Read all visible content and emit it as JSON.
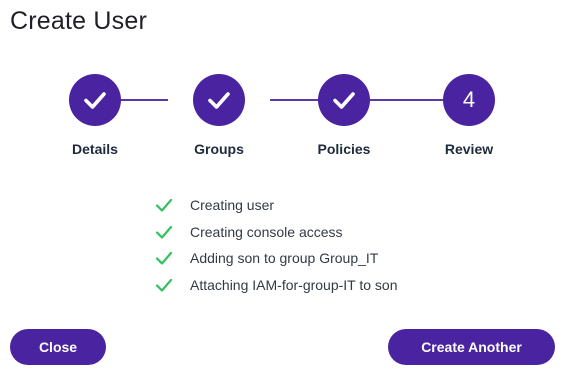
{
  "page": {
    "title": "Create User"
  },
  "stepper": {
    "steps": [
      {
        "label": "Details",
        "status": "complete",
        "icon": "check-icon"
      },
      {
        "label": "Groups",
        "status": "complete",
        "icon": "check-icon"
      },
      {
        "label": "Policies",
        "status": "complete",
        "icon": "check-icon"
      },
      {
        "label": "Review",
        "status": "current",
        "number": "4"
      }
    ],
    "accent_color": "#4a24a0"
  },
  "progress_log": {
    "items": [
      {
        "text": "Creating user",
        "status": "success",
        "icon": "check-icon"
      },
      {
        "text": "Creating console access",
        "status": "success",
        "icon": "check-icon"
      },
      {
        "text": "Adding son to group Group_IT",
        "status": "success",
        "icon": "check-icon"
      },
      {
        "text": "Attaching IAM-for-group-IT to son",
        "status": "success",
        "icon": "check-icon"
      }
    ],
    "success_color": "#2fc25b"
  },
  "actions": {
    "close_label": "Close",
    "create_another_label": "Create Another"
  }
}
